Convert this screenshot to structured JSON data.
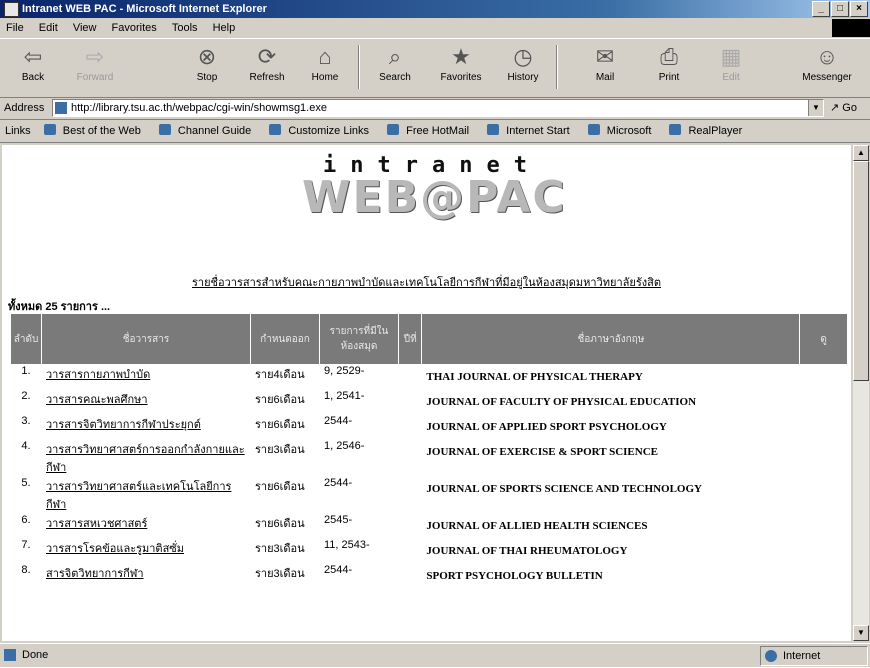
{
  "window": {
    "title": "Intranet WEB PAC - Microsoft Internet Explorer",
    "controls": [
      "_",
      "□",
      "×"
    ]
  },
  "menu": [
    "File",
    "Edit",
    "View",
    "Favorites",
    "Tools",
    "Help"
  ],
  "toolbar": [
    {
      "label": "Back",
      "icon": "back-arrow-icon",
      "glyph": "⇦",
      "enabled": true
    },
    {
      "label": "Forward",
      "icon": "forward-arrow-icon",
      "glyph": "⇨",
      "enabled": false
    },
    {
      "label": "Stop",
      "icon": "stop-icon",
      "glyph": "⊗",
      "enabled": true
    },
    {
      "label": "Refresh",
      "icon": "refresh-icon",
      "glyph": "⟳",
      "enabled": true
    },
    {
      "label": "Home",
      "icon": "home-icon",
      "glyph": "⌂",
      "enabled": true
    },
    {
      "label": "Search",
      "icon": "search-icon",
      "glyph": "⌕",
      "enabled": true
    },
    {
      "label": "Favorites",
      "icon": "favorites-icon",
      "glyph": "★",
      "enabled": true
    },
    {
      "label": "History",
      "icon": "history-icon",
      "glyph": "◷",
      "enabled": true
    },
    {
      "label": "Mail",
      "icon": "mail-icon",
      "glyph": "✉",
      "enabled": true
    },
    {
      "label": "Print",
      "icon": "print-icon",
      "glyph": "⎙",
      "enabled": true
    },
    {
      "label": "Edit",
      "icon": "edit-icon",
      "glyph": "▦",
      "enabled": false
    },
    {
      "label": "Messenger",
      "icon": "messenger-icon",
      "glyph": "☺",
      "enabled": true
    }
  ],
  "address": {
    "label": "Address",
    "url": "http://library.tsu.ac.th/webpac/cgi-win/showmsg1.exe",
    "go": "Go"
  },
  "links": {
    "label": "Links",
    "items": [
      "Best of the Web",
      "Channel Guide",
      "Customize Links",
      "Free HotMail",
      "Internet Start",
      "Microsoft",
      "RealPlayer"
    ]
  },
  "page": {
    "brand_top": "intranet",
    "brand_main": "WEB@PAC",
    "heading": "รายชื่อวารสารสำหรับคณะกายภาพบำบัดและเทคโนโลยีการกีฬาที่มีอยู่ในห้องสมุดมหาวิทยาลัยรังสิต",
    "count": "ทั้งหมด 25 รายการ ...",
    "table_headers": [
      "ลำดับ",
      "ชื่อวารสาร",
      "กำหนดออก",
      "รายการที่มีในห้องสมุด",
      "ปีที่",
      "ชื่อภาษาอังกฤษ",
      "ดู"
    ],
    "rows": [
      {
        "no": "1.",
        "thai": "วารสารกายภาพบำบัด",
        "freq": "ราย4เดือน",
        "vol": "9, 2529-",
        "en": "THAI JOURNAL OF PHYSICAL THERAPY"
      },
      {
        "no": "2.",
        "thai": "วารสารคณะพลศึกษา",
        "freq": "ราย6เดือน",
        "vol": "1, 2541-",
        "en": "JOURNAL OF FACULTY OF PHYSICAL EDUCATION"
      },
      {
        "no": "3.",
        "thai": "วารสารจิตวิทยาการกีฬาประยุกต์",
        "freq": "ราย6เดือน",
        "vol": "2544-",
        "en": "JOURNAL OF APPLIED SPORT PSYCHOLOGY"
      },
      {
        "no": "4.",
        "thai": "วารสารวิทยาศาสตร์การออกกำลังกายและกีฬา",
        "freq": "ราย3เดือน",
        "vol": "1, 2546-",
        "en": "JOURNAL OF EXERCISE & SPORT SCIENCE"
      },
      {
        "no": "5.",
        "thai": "วารสารวิทยาศาสตร์และเทคโนโลยีการกีฬา",
        "freq": "ราย6เดือน",
        "vol": "2544-",
        "en": "JOURNAL OF SPORTS SCIENCE AND TECHNOLOGY"
      },
      {
        "no": "6.",
        "thai": "วารสารสหเวชศาสตร์",
        "freq": "ราย6เดือน",
        "vol": "2545-",
        "en": "JOURNAL OF ALLIED HEALTH SCIENCES"
      },
      {
        "no": "7.",
        "thai": "วารสารโรคข้อและรูมาติสซั่ม",
        "freq": "ราย3เดือน",
        "vol": "11, 2543-",
        "en": "JOURNAL OF THAI RHEUMATOLOGY"
      },
      {
        "no": "8.",
        "thai": "สารจิตวิทยาการกีฬา",
        "freq": "ราย3เดือน",
        "vol": "2544-",
        "en": "SPORT PSYCHOLOGY BULLETIN"
      }
    ]
  },
  "status": {
    "text": "Done",
    "zone": "Internet"
  }
}
